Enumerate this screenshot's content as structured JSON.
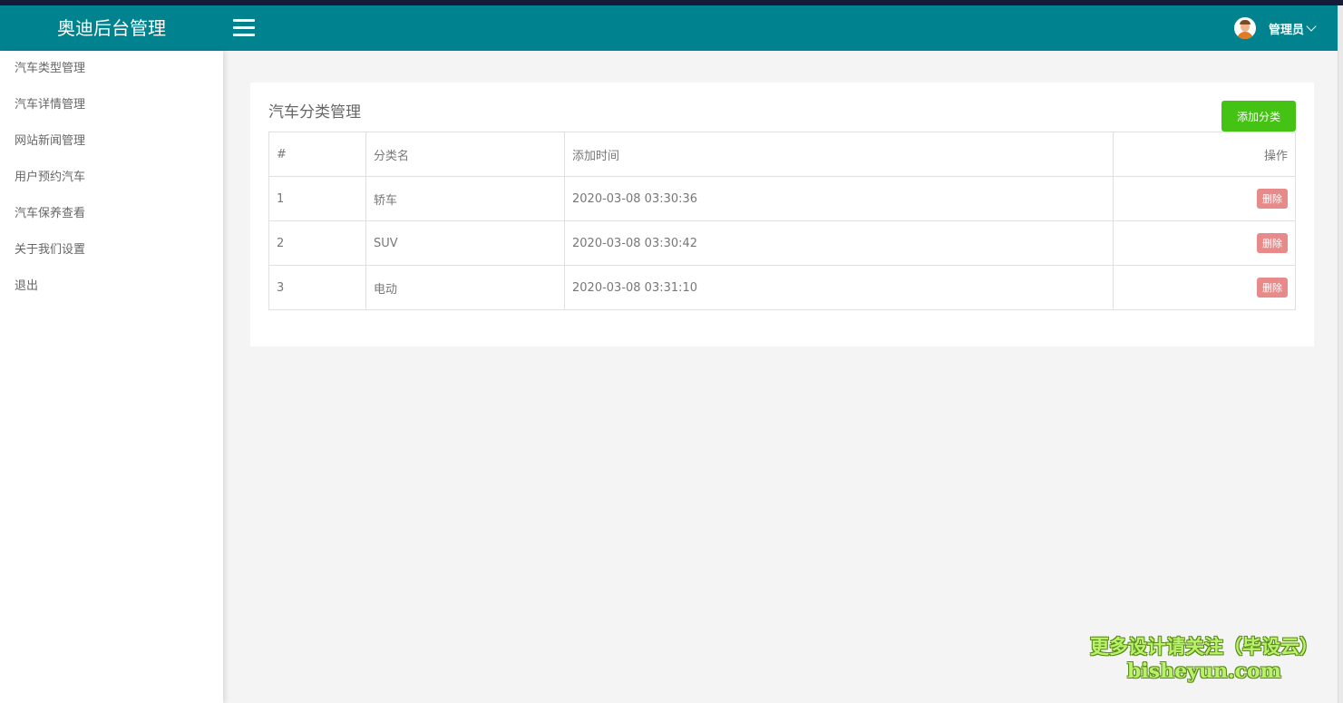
{
  "app": {
    "title": "奥迪后台管理"
  },
  "header": {
    "user_label": "管理员"
  },
  "sidebar": {
    "items": [
      {
        "label": "汽车类型管理"
      },
      {
        "label": "汽车详情管理"
      },
      {
        "label": "网站新闻管理"
      },
      {
        "label": "用户预约汽车"
      },
      {
        "label": "汽车保养查看"
      },
      {
        "label": "关于我们设置"
      },
      {
        "label": "退出"
      }
    ]
  },
  "main": {
    "title": "汽车分类管理",
    "add_button": "添加分类",
    "table": {
      "headers": [
        "#",
        "分类名",
        "添加时间",
        "操作"
      ],
      "rows": [
        {
          "id": "1",
          "name": "轿车",
          "time": "2020-03-08 03:30:36",
          "action": "删除"
        },
        {
          "id": "2",
          "name": "SUV",
          "time": "2020-03-08 03:30:42",
          "action": "删除"
        },
        {
          "id": "3",
          "name": "电动",
          "time": "2020-03-08 03:31:10",
          "action": "删除"
        }
      ]
    }
  },
  "watermark": {
    "line1": "更多设计请关注（毕设云）",
    "line2": "bisheyun.com"
  },
  "colors": {
    "header": "#00838f",
    "add_button": "#44c314",
    "delete_badge": "#e88a8a"
  }
}
